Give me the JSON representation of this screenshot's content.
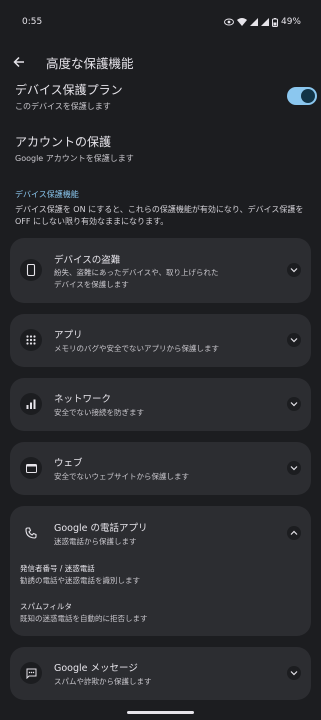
{
  "status": {
    "time": "0:55",
    "battery": "49%"
  },
  "appbar": {
    "title": "高度な保護機能"
  },
  "device_protection": {
    "title": "デバイス保護プラン",
    "subtitle": "このデバイスを保護します",
    "enabled": true
  },
  "account_protection": {
    "title": "アカウントの保護",
    "subtitle": "Google アカウントを保護します"
  },
  "section": {
    "heading": "デバイス保護機能",
    "description": "デバイス保護を ON にすると、これらの保護機能が有効になり、デバイス保護を OFF にしない限り有効なままになります。"
  },
  "cards": [
    {
      "title": "デバイスの盗難",
      "sub1": "紛失、盗難にあったデバイスや、取り上げられた",
      "sub2": "デバイスを保護します",
      "icon": "phone-icon"
    },
    {
      "title": "アプリ",
      "sub1": "メモリのバグや安全でないアプリから保護します",
      "icon": "apps-grid-icon"
    },
    {
      "title": "ネットワーク",
      "sub1": "安全でない接続を防ぎます",
      "icon": "signal-bars-icon"
    },
    {
      "title": "ウェブ",
      "sub1": "安全でないウェブサイトから保護します",
      "icon": "browser-icon"
    },
    {
      "title": "Google の電話アプリ",
      "sub1": "迷惑電話から保護します",
      "icon": "phone-call-icon",
      "details": [
        {
          "title": "発信者番号 / 迷惑電話",
          "sub": "勧誘の電話や迷惑電話を識別します"
        },
        {
          "title": "スパムフィルタ",
          "sub": "既知の迷惑電話を自動的に拒否します"
        }
      ]
    },
    {
      "title": "Google メッセージ",
      "sub1": "スパムや詐欺から保護します",
      "icon": "message-icon"
    }
  ]
}
